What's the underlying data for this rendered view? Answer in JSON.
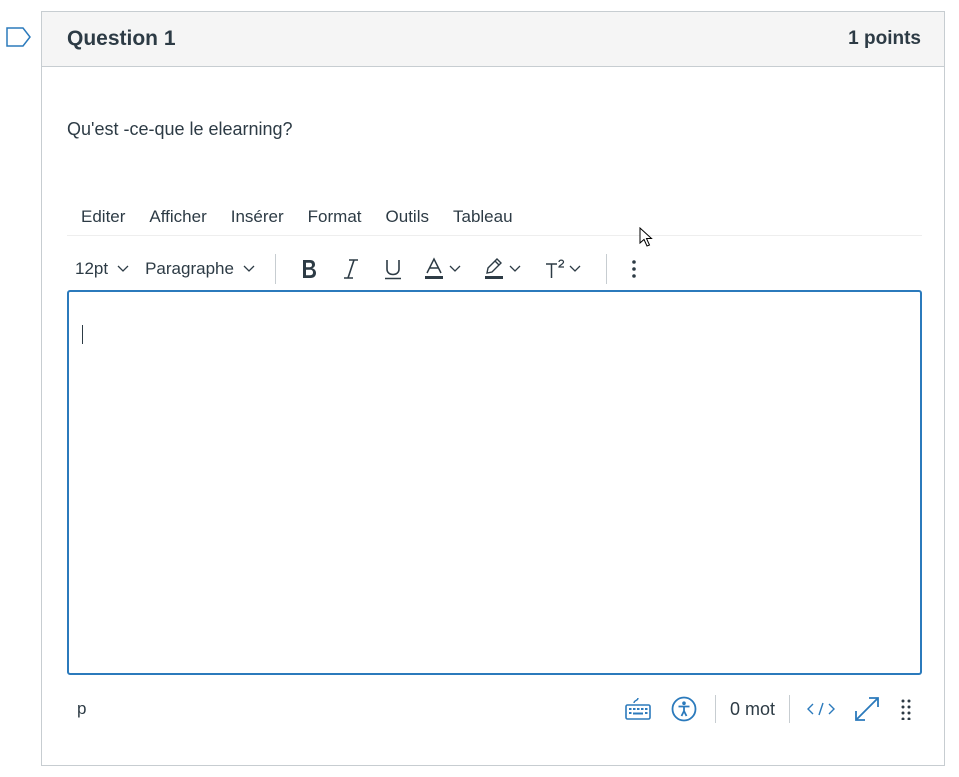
{
  "question": {
    "title": "Question 1",
    "points": "1 points",
    "text": "Qu'est -ce-que le elearning?"
  },
  "menubar": {
    "items": [
      {
        "label": "Editer"
      },
      {
        "label": "Afficher"
      },
      {
        "label": "Insérer"
      },
      {
        "label": "Format"
      },
      {
        "label": "Outils"
      },
      {
        "label": "Tableau"
      }
    ]
  },
  "toolbar": {
    "font_size": "12pt",
    "block_format": "Paragraphe",
    "icons": [
      "bold-icon",
      "italic-icon",
      "underline-icon",
      "text-color-icon",
      "highlight-icon",
      "superscript-icon",
      "more-vertical-icon"
    ]
  },
  "editor": {
    "content": ""
  },
  "statusbar": {
    "path": "p",
    "word_count": "0 mot",
    "icons": [
      "keyboard-icon",
      "accessibility-icon",
      "html-code-icon",
      "fullscreen-icon",
      "resize-handle-icon"
    ]
  },
  "colors": {
    "accent": "#2b7abc",
    "text": "#2d3b45",
    "header_bg": "#f5f5f5",
    "border": "#c7cdd1"
  }
}
